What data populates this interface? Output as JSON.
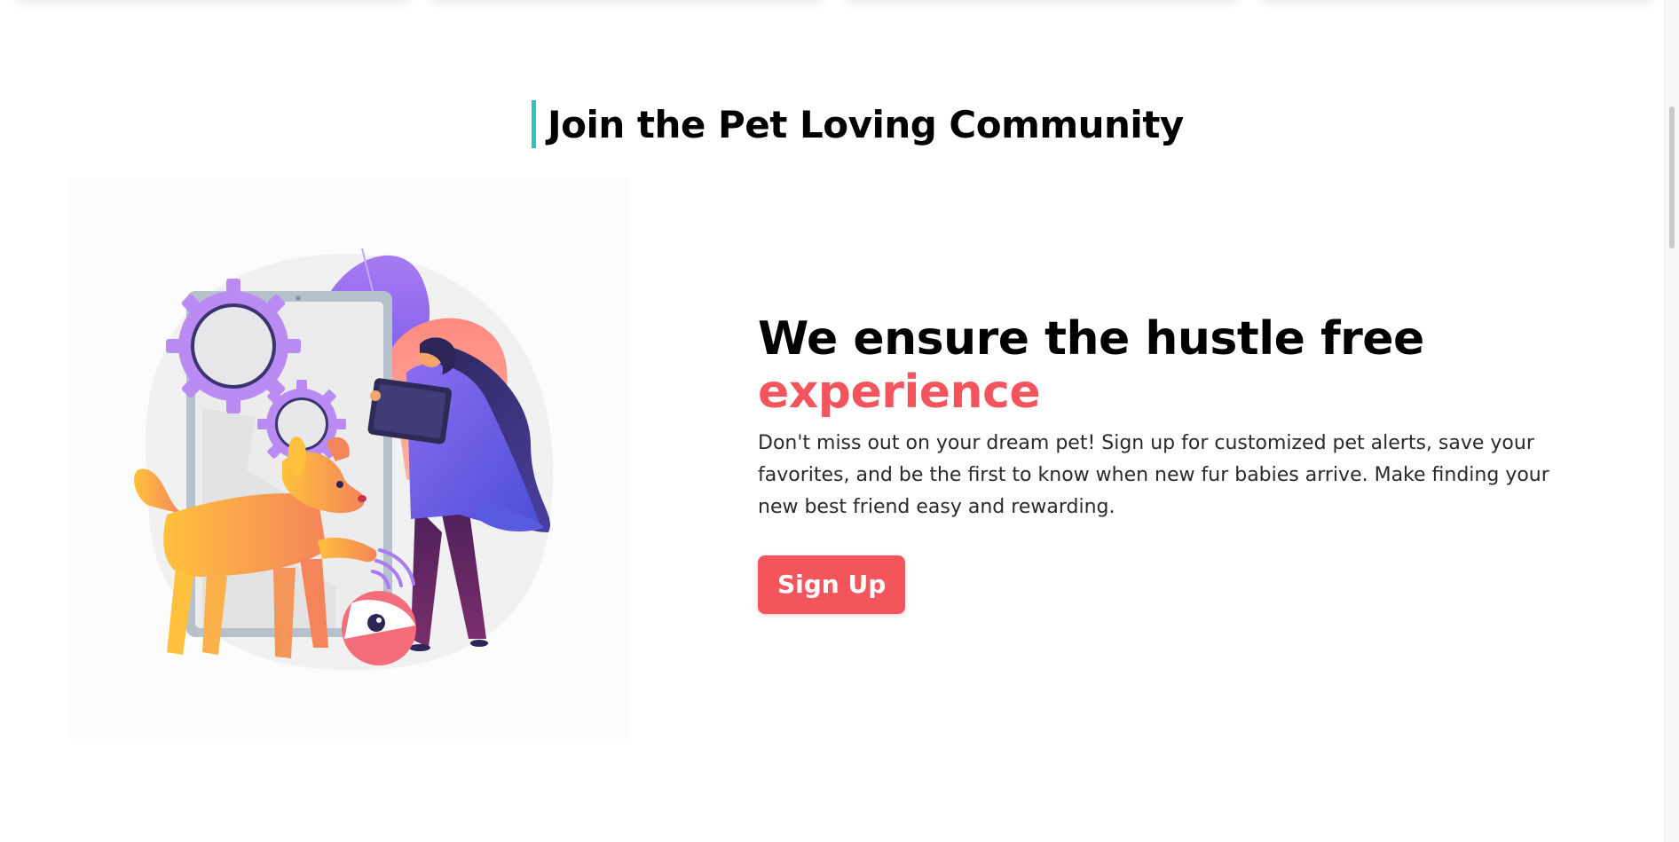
{
  "section": {
    "heading": "Join the Pet Loving Community",
    "accent_color": "#2ec4b6"
  },
  "hero": {
    "headline_main": "We ensure the hustle free",
    "headline_accent": "experience",
    "accent_color": "#f4545c",
    "description": "Don't miss out on your dream pet! Sign up for customized pet alerts, save your favorites, and be the first to know when new fur babies arrive. Make finding your new best friend easy and rewarding.",
    "signup_label": "Sign Up"
  },
  "illustration": {
    "icon": "woman-with-tablet-and-dog-illustration"
  }
}
